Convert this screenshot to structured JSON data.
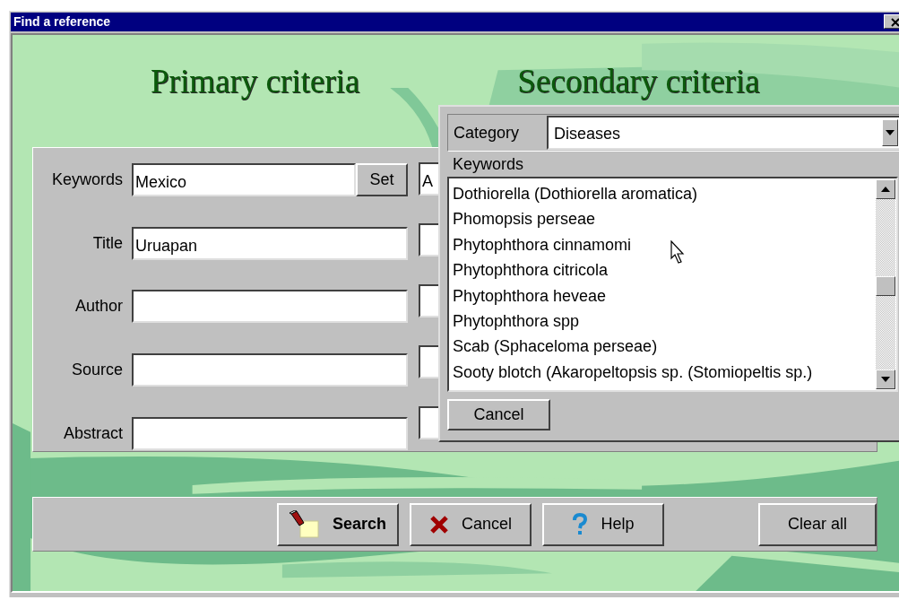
{
  "window": {
    "title": "Find a reference"
  },
  "primary": {
    "heading": "Primary criteria",
    "fields": [
      {
        "label": "Keywords",
        "value": "Mexico",
        "kind": "with-button",
        "button": "Set"
      },
      {
        "label": "Title",
        "value": "Uruapan",
        "kind": "plain"
      },
      {
        "label": "Author",
        "kind": "plain"
      },
      {
        "label": "Source",
        "kind": "plain"
      },
      {
        "label": "Abstract",
        "kind": "plain"
      }
    ]
  },
  "secondary": {
    "heading": "Secondary criteria",
    "fields": [
      {
        "kind": "filled",
        "value": "A"
      },
      {
        "kind": "blank"
      },
      {
        "kind": "blank"
      },
      {
        "kind": "blank"
      },
      {
        "kind": "blank"
      }
    ]
  },
  "buttons": [
    {
      "label": "Search",
      "kind": "search"
    },
    {
      "label": "Cancel",
      "kind": "cancel"
    },
    {
      "label": "Help",
      "kind": "help"
    },
    {
      "label": "Clear all",
      "kind": "plain"
    }
  ],
  "popup": {
    "category_label": "Category",
    "category": "Diseases",
    "list_header": "Keywords",
    "items": [
      "Dothiorella (Dothiorella aromatica)",
      "Phomopsis perseae",
      "Phytophthora cinnamomi",
      "Phytophthora citricola",
      "Phytophthora heveae",
      "Phytophthora spp",
      "Scab (Sphaceloma perseae)",
      "Sooty blotch (Akaropeltopsis sp. (Stomiopeltis sp.)"
    ],
    "cancel": "Cancel"
  }
}
